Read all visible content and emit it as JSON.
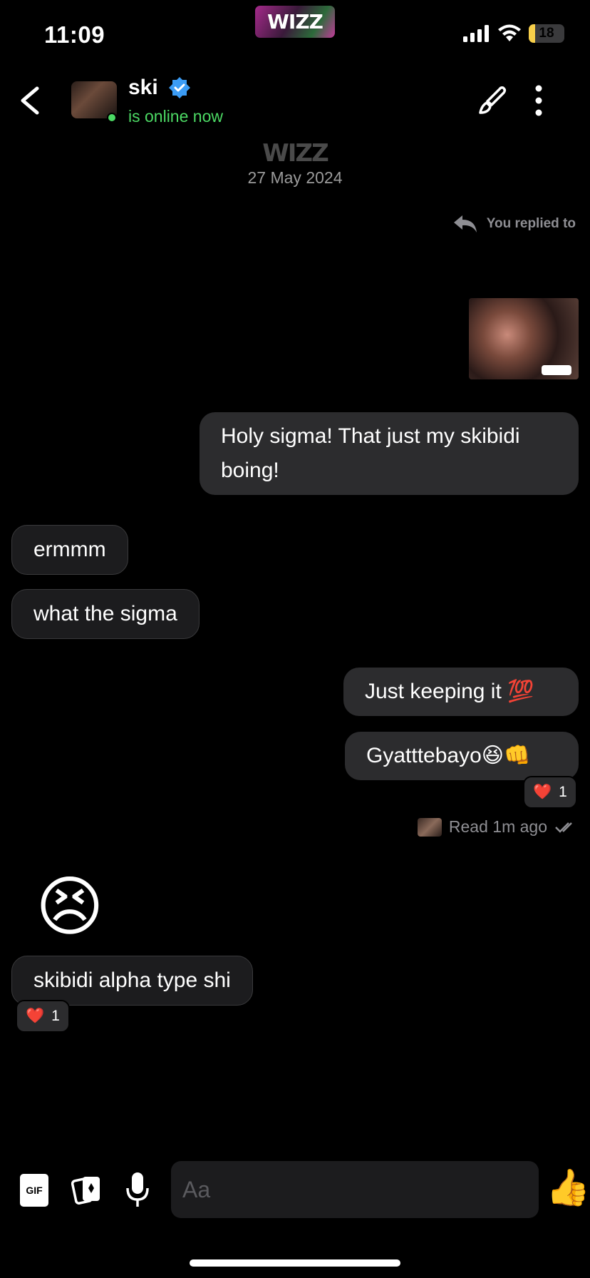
{
  "status_bar": {
    "time": "11:09",
    "app_badge": "WIZZ",
    "battery": "18",
    "battery_fraction": 0.18
  },
  "header": {
    "name": "ski",
    "presence": "is online now",
    "verified_icon": "verified-badge-icon"
  },
  "date_separator": {
    "logo": "WIZZ",
    "date": "27 May 2024"
  },
  "replied_note": "You replied to",
  "messages": [
    {
      "side": "sent",
      "text": "Holy sigma! That just my skibidi boing!"
    },
    {
      "side": "received",
      "text": "ermmm"
    },
    {
      "side": "received",
      "text": "what the sigma"
    },
    {
      "side": "sent",
      "text": "Just keeping it 💯"
    },
    {
      "side": "sent",
      "text": "Gyatttebayo😆👊",
      "reaction": {
        "emoji": "❤️",
        "count": "1"
      }
    },
    {
      "side": "received",
      "text": "😣"
    },
    {
      "side": "received",
      "text": "skibidi alpha type shi",
      "reaction": {
        "emoji": "❤️",
        "count": "1"
      }
    }
  ],
  "read_receipt": "Read 1m ago",
  "composer": {
    "gif_label": "GIF",
    "placeholder": "Aa",
    "like_emoji": "👍"
  },
  "colors": {
    "accent_online": "#4cd964",
    "bubble_sent": "#2c2c2e",
    "bubble_received": "#1c1c1e",
    "verified": "#3b9cf5"
  }
}
